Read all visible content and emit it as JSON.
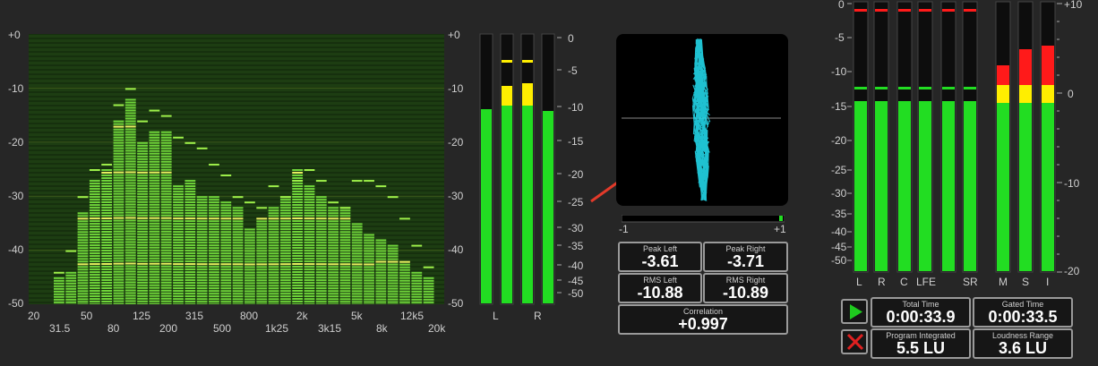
{
  "spectrum": {
    "y_ticks": [
      "+0",
      "-10",
      "-20",
      "-30",
      "-40",
      "-50"
    ],
    "x_ticks_top": [
      "20",
      "50",
      "125",
      "315",
      "800",
      "2k",
      "5k",
      "12k5"
    ],
    "x_ticks_bottom": [
      "31.5",
      "80",
      "200",
      "500",
      "1k25",
      "3k15",
      "8k",
      "20k"
    ],
    "bands_db": [
      -45,
      -44,
      -33,
      -27,
      -25,
      -16,
      -12,
      -20,
      -18,
      -18,
      -28,
      -27,
      -30,
      -30,
      -31,
      -32,
      -36,
      -34,
      -32,
      -30,
      -25,
      -28,
      -30,
      -32,
      -32,
      -35,
      -37,
      -38,
      -39,
      -42,
      -44,
      -45
    ],
    "peak_db": [
      -44,
      -40,
      -30,
      -25,
      -24,
      -13,
      -10,
      -16,
      -14,
      -15,
      -19,
      -20,
      -21,
      -24,
      -26,
      -30,
      -31,
      -32,
      -28,
      -30,
      -27,
      -25,
      -27,
      -31,
      -32,
      -27,
      -27,
      -28,
      -30,
      -34,
      -39,
      -43
    ]
  },
  "level_meter": {
    "scale_left": [
      "+0",
      "-10",
      "-20",
      "-30",
      "-40",
      "-50"
    ],
    "scale_right": [
      "0",
      "-5",
      "-10",
      "-15",
      "-20",
      "-25",
      "-30",
      "-35",
      "-40",
      "-45",
      "-50"
    ],
    "channels": [
      "L",
      "R"
    ]
  },
  "phase": {
    "axis_left": "-1",
    "axis_right": "+1",
    "peak_left_label": "Peak Left",
    "peak_left_value": "-3.61",
    "peak_right_label": "Peak Right",
    "peak_right_value": "-3.71",
    "rms_left_label": "RMS Left",
    "rms_left_value": "-10.88",
    "rms_right_label": "RMS Right",
    "rms_right_value": "-10.89",
    "correlation_label": "Correlation",
    "correlation_value": "+0.997"
  },
  "loudness": {
    "scale_left": [
      "0",
      "-5",
      "-10",
      "-15",
      "-20",
      "-25",
      "-30",
      "-35",
      "-40",
      "-45",
      "-50"
    ],
    "scale_right": [
      "+10",
      "0",
      "-10",
      "-20"
    ],
    "channels": [
      "L",
      "R",
      "C",
      "LFE",
      "SR"
    ],
    "lu_channels": [
      "M",
      "S",
      "I"
    ],
    "total_time_label": "Total Time",
    "total_time_value": "0:00:33.9",
    "gated_time_label": "Gated Time",
    "gated_time_value": "0:00:33.5",
    "program_label": "Program Integrated",
    "program_value": "5.5 LU",
    "range_label": "Loudness Range",
    "range_value": "3.6 LU"
  },
  "colors": {
    "green": "#22dd22",
    "yellow": "#ffee00",
    "red": "#ff1a1a",
    "scope": "#22d6e8",
    "arrow": "#e23a2a"
  }
}
